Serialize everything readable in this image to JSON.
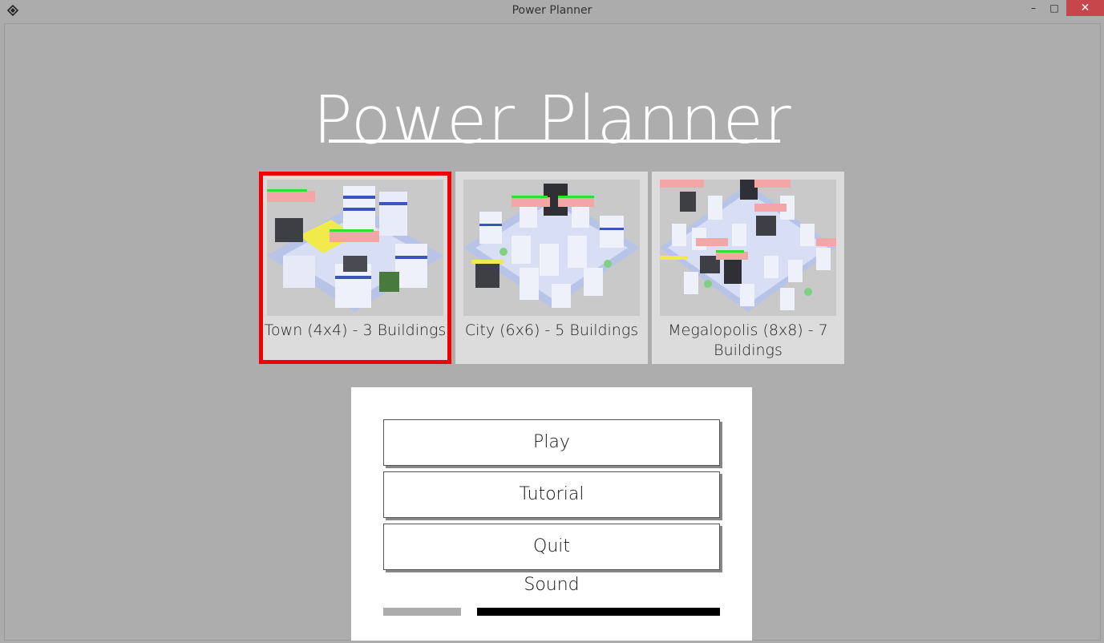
{
  "window": {
    "title": "Power Planner",
    "minimize_glyph": "–",
    "maximize_glyph": "□",
    "close_glyph": "✕"
  },
  "game": {
    "title": "Power Planner"
  },
  "levels": [
    {
      "label": "Town (4x4) - 3 Buildings",
      "selected": true
    },
    {
      "label": "City (6x6) - 5 Buildings",
      "selected": false
    },
    {
      "label": "Megalopolis (8x8) - 7 Buildings",
      "selected": false
    }
  ],
  "menu": {
    "play_label": "Play",
    "tutorial_label": "Tutorial",
    "quit_label": "Quit",
    "sound_label": "Sound"
  },
  "sound_slider": {
    "level": 0.24
  },
  "colors": {
    "background": "#acacac",
    "selected_border": "#f20000",
    "close_button": "#c7464b"
  }
}
